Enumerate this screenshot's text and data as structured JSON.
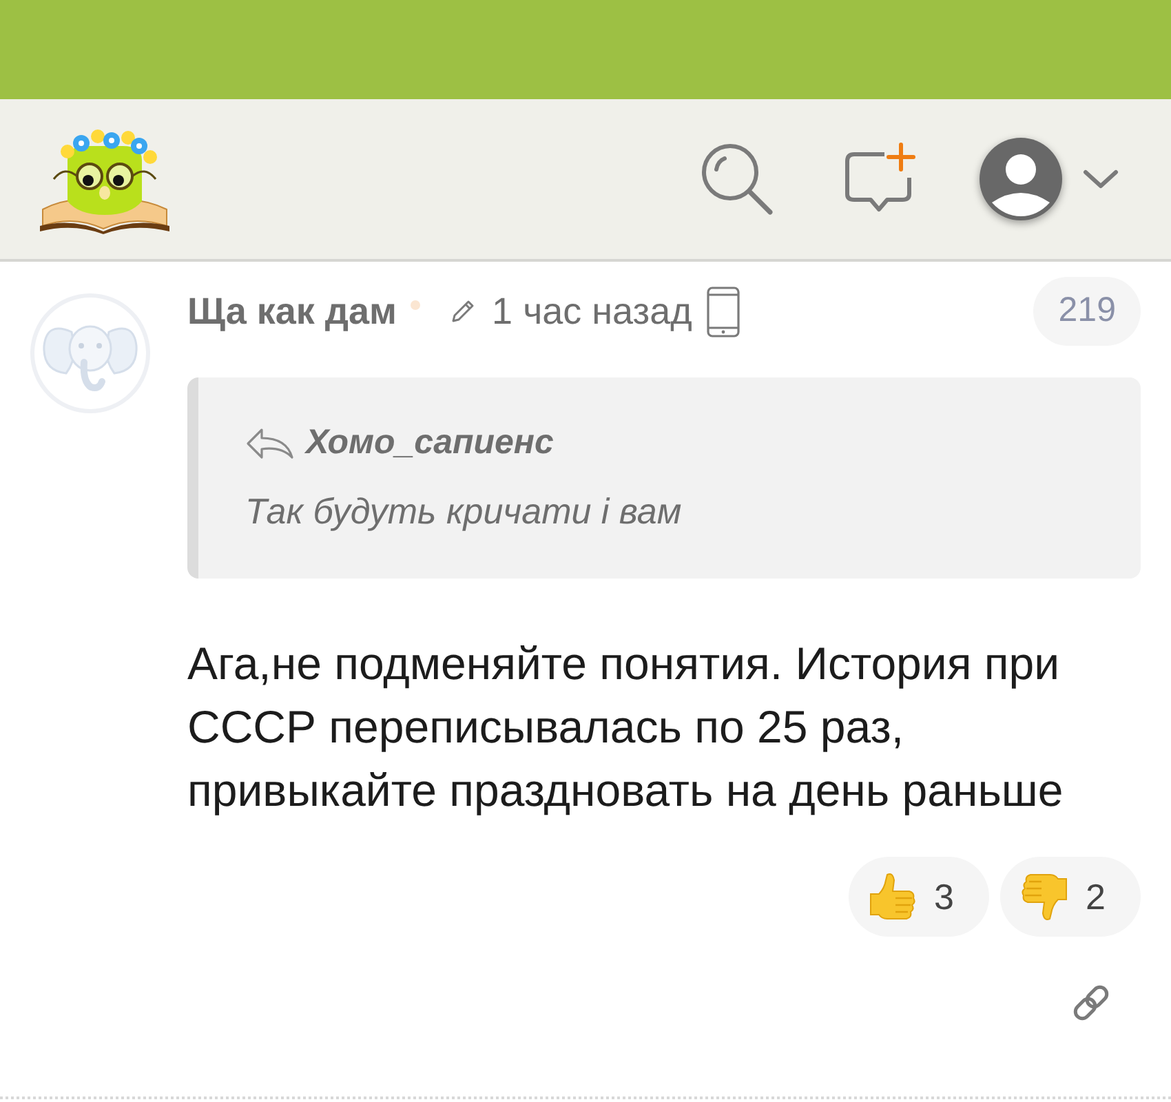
{
  "comment": {
    "author": "Ща как дам",
    "online": true,
    "edited": true,
    "time": "1 час назад",
    "from_mobile": true,
    "rating": "219",
    "quote": {
      "author": "Хомо_сапиенс",
      "text": "Так будуть кричати і вам"
    },
    "body": "Ага,не подменяйте понятия. История при СССР переписывалась по 25 раз, привыкайте праздновать на день раньше",
    "reactions": [
      {
        "kind": "like",
        "count": "3"
      },
      {
        "kind": "dislike",
        "count": "2"
      }
    ]
  }
}
